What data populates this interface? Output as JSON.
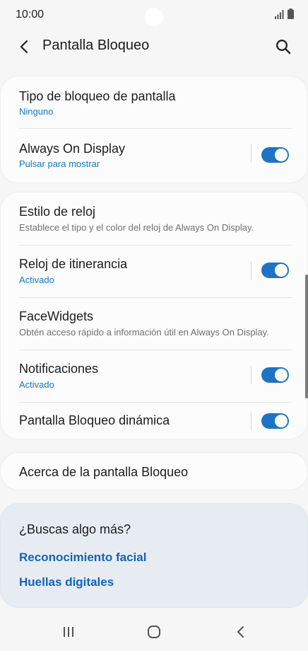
{
  "status_bar": {
    "time": "10:00"
  },
  "header": {
    "title": "Pantalla Bloqueo"
  },
  "section1": [
    {
      "title": "Tipo de bloqueo de pantalla",
      "subtitle": "Ninguno"
    },
    {
      "title": "Always On Display",
      "subtitle": "Pulsar para mostrar",
      "toggle": true
    }
  ],
  "section2": [
    {
      "title": "Estilo de reloj",
      "subtitle": "Establece el tipo y el color del reloj de Always On Display."
    },
    {
      "title": "Reloj de itinerancia",
      "subtitle": "Activado",
      "toggle": true
    },
    {
      "title": "FaceWidgets",
      "subtitle": "Obtén acceso rápido a información útil en Always On Display."
    },
    {
      "title": "Notificaciones",
      "subtitle": "Activado",
      "toggle": true
    },
    {
      "title": "Pantalla Bloqueo dinámica",
      "toggle": true
    }
  ],
  "section3": {
    "title": "Acerca de la pantalla Bloqueo"
  },
  "more": {
    "title": "¿Buscas algo más?",
    "links": [
      "Reconocimiento facial",
      "Huellas digitales"
    ]
  },
  "colors": {
    "accent": "#1f73c7",
    "link": "#1463b6",
    "subtitle_blue": "#1576c8"
  },
  "icons": [
    "back-arrow-icon",
    "search-icon",
    "signal-icon",
    "battery-icon",
    "recent-apps-icon",
    "home-icon",
    "nav-back-icon"
  ]
}
